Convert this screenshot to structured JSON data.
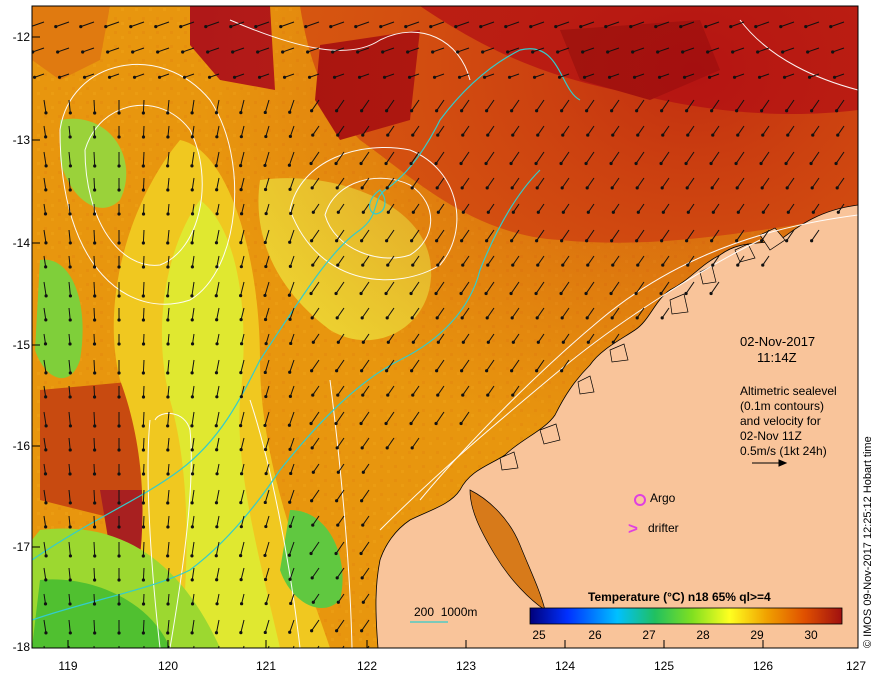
{
  "map": {
    "lat_labels": [
      "-12",
      "-13",
      "-14",
      "-15",
      "-16",
      "-17",
      "-18"
    ],
    "lon_labels": [
      "119",
      "120",
      "121",
      "122",
      "123",
      "124",
      "125",
      "126",
      "127"
    ],
    "date": "02-Nov-2017",
    "time": "11:14Z",
    "info_lines": [
      "Altimetric sealevel",
      "(0.1m contours)",
      "and velocity for",
      "02-Nov 11Z",
      "0.5m/s (1kt 24h)"
    ],
    "legend_argo": "Argo",
    "legend_drifter": "drifter",
    "depth_label": "200  1000m",
    "colorbar_title": "Temperature (°C) n18 65% ql>=4",
    "colorbar_ticks": [
      "25",
      "26",
      "27",
      "28",
      "29",
      "30"
    ],
    "credit": "© IMOS 09-Nov-2017 12:25:12 Hobart time",
    "colors": {
      "land": "#f9c49a",
      "contour": "#ffffff",
      "bathymetry": "#33cccc",
      "marker": "#e040e0"
    }
  }
}
